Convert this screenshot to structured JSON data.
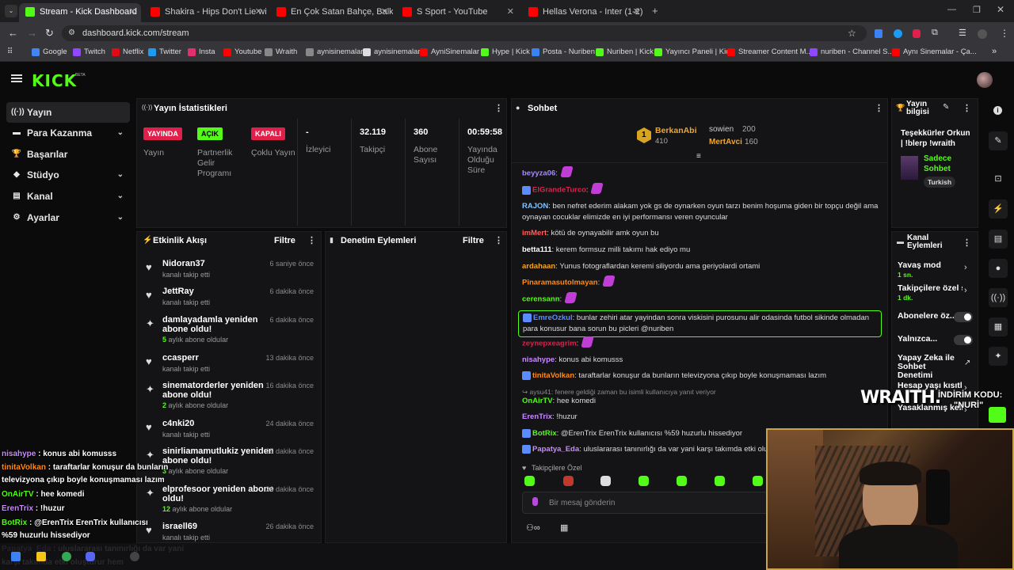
{
  "browser": {
    "tabs": [
      {
        "label": "Stream - Kick Dashboard",
        "active": true,
        "color": "#53fc18"
      },
      {
        "label": "Shakira - Hips Don't Lie with Ed",
        "active": false,
        "color": "#ff0000"
      },
      {
        "label": "En Çok Satan Bahçe, Balkon ve",
        "active": false,
        "color": "#ff0000"
      },
      {
        "label": "S Sport - YouTube",
        "active": false,
        "color": "#ff0000"
      },
      {
        "label": "Hellas Verona - Inter (1-2) - Ma",
        "active": false,
        "color": "#ff0000"
      }
    ],
    "url": "dashboard.kick.com/stream",
    "bookmarks": [
      {
        "label": "Google",
        "color": "#4285f4"
      },
      {
        "label": "Twitch",
        "color": "#9146ff"
      },
      {
        "label": "Netflix",
        "color": "#e50914"
      },
      {
        "label": "Twitter",
        "color": "#1d9bf0"
      },
      {
        "label": "Insta",
        "color": "#e1306c"
      },
      {
        "label": "Youtube",
        "color": "#ff0000"
      },
      {
        "label": "Wraith",
        "color": "#888888"
      },
      {
        "label": "aynisinemalar",
        "color": "#888888"
      },
      {
        "label": "aynisinemalar",
        "color": "#dddddd"
      },
      {
        "label": "AyniSinemalar",
        "color": "#ff0000"
      },
      {
        "label": "Hype | Kick",
        "color": "#53fc18"
      },
      {
        "label": "Posta - Nuriben",
        "color": "#3b82f6"
      },
      {
        "label": "Nuriben | Kick",
        "color": "#53fc18"
      },
      {
        "label": "Yayıncı Paneli | Kick",
        "color": "#53fc18"
      },
      {
        "label": "Streamer Content M...",
        "color": "#ff0000"
      },
      {
        "label": "nuriben - Channel S...",
        "color": "#9146ff"
      },
      {
        "label": "Aynı Sinemalar - Ça...",
        "color": "#ff0000"
      }
    ]
  },
  "sidebar": {
    "items": [
      {
        "label": "Yayın",
        "icon": "broadcast-icon",
        "glyph": "((·))",
        "chevron": false
      },
      {
        "label": "Para Kazanma",
        "icon": "money-icon",
        "glyph": "▬",
        "chevron": true
      },
      {
        "label": "Başarılar",
        "icon": "trophy-icon",
        "glyph": "🏆",
        "chevron": false
      },
      {
        "label": "Stüdyo",
        "icon": "studio-icon",
        "glyph": "◆",
        "chevron": true
      },
      {
        "label": "Kanal",
        "icon": "channel-icon",
        "glyph": "▤",
        "chevron": true
      },
      {
        "label": "Ayarlar",
        "icon": "gear-icon",
        "glyph": "⚙",
        "chevron": true
      }
    ]
  },
  "stats": {
    "title": "Yayın İstatistikleri",
    "badges": [
      {
        "badge": "YAYINDA",
        "label": "Yayın",
        "color": "#e0204a",
        "text": "#ffffff"
      },
      {
        "badge": "AÇIK",
        "label": "Partnerlik Gelir Programı",
        "color": "#53fc18",
        "text": "#000000"
      },
      {
        "badge": "KAPALI",
        "label": "Çoklu Yayın",
        "color": "#e0204a",
        "text": "#ffffff"
      }
    ],
    "values": [
      {
        "value": "-",
        "label": "İzleyici"
      },
      {
        "value": "32.119",
        "label": "Takipçi"
      },
      {
        "value": "360",
        "label": "Abone Sayısı"
      },
      {
        "value": "00:59:58",
        "label": "Yayında Olduğu Süre"
      }
    ]
  },
  "activity": {
    "title": "Etkinlik Akışı",
    "filter": "Filtre",
    "items": [
      {
        "name": "Nidoran37",
        "sub": "kanalı takip etti",
        "months": "",
        "time": "6 saniye önce",
        "icon": "heart"
      },
      {
        "name": "JettRay",
        "sub": "kanalı takip etti",
        "months": "",
        "time": "6 dakika önce",
        "icon": "heart"
      },
      {
        "name": "damlayadamla yeniden abone oldu!",
        "sub": " aylık abone oldular",
        "months": "5",
        "time": "6 dakika önce",
        "icon": "star"
      },
      {
        "name": "ccasperr",
        "sub": "kanalı takip etti",
        "months": "",
        "time": "13 dakika önce",
        "icon": "heart"
      },
      {
        "name": "sinematorderler yeniden abone oldu!",
        "sub": " aylık abone oldular",
        "months": "2",
        "time": "16 dakika önce",
        "icon": "star"
      },
      {
        "name": "c4nki20",
        "sub": "kanalı takip etti",
        "months": "",
        "time": "24 dakika önce",
        "icon": "heart"
      },
      {
        "name": "sinirliamamutlukiz yeniden abone oldu!",
        "sub": " aylık abone oldular",
        "months": "3",
        "time": "25 dakika önce",
        "icon": "star"
      },
      {
        "name": "elprofesoor yeniden abone oldu!",
        "sub": " aylık abone oldular",
        "months": "12",
        "time": "26 dakika önce",
        "icon": "star"
      },
      {
        "name": "israell69",
        "sub": "kanalı takip etti",
        "months": "",
        "time": "26 dakika önce",
        "icon": "heart"
      }
    ]
  },
  "moderation": {
    "title": "Denetim Eylemleri",
    "filter": "Filtre"
  },
  "chat": {
    "title": "Sohbet",
    "leaders": [
      {
        "rank": "1",
        "name": "BerkanAbi",
        "count": "410"
      },
      {
        "rank": "",
        "name": "sowien",
        "count": "200"
      },
      {
        "rank": "",
        "name": "MertAvci",
        "count": "160"
      }
    ],
    "messages": [
      {
        "user": "beyyza06",
        "color": "#a58bff",
        "text": "",
        "emote": true
      },
      {
        "user": "ElGrandeTurco",
        "color": "#e0204a",
        "text": "",
        "emote": true
      },
      {
        "user": "RAJON",
        "color": "#7fc4ff",
        "text": "ben nefret ederim alakam yok gs de oynarken oyun tarzı benim hoşuma giden bir topçu değil ama oynayan cocuklar elimizde en iyi performansı veren oyuncular"
      },
      {
        "user": "imMert",
        "color": "#ff5f5f",
        "text": "kötü de oynayabilir amk oyun bu"
      },
      {
        "user": "betta111",
        "color": "#ffffff",
        "text": "kerem formsuz milli takımı hak ediyo mu"
      },
      {
        "user": "ardahaan",
        "color": "#f5a623",
        "text": "Yunus fotograflardan keremi siliyordu ama geriyolardi ortami"
      },
      {
        "user": "Pinaramasutolmayan",
        "color": "#ff8c1a",
        "text": "",
        "emote": true
      },
      {
        "user": "cerensann",
        "color": "#53fc18",
        "text": "",
        "emote": true
      },
      {
        "user": "EmreOzkul",
        "color": "#5a8cff",
        "text": "bunlar zehiri atar yayindan sonra viskisini purosunu alir odasinda futbol sikinde olmadan para konusur bana sorun bu picleri @nuriben"
      },
      {
        "user": "zeynepxeagrim",
        "color": "#e0204a",
        "text": "",
        "emote": true
      },
      {
        "user": "nisahype",
        "color": "#c98bff",
        "text": "konus abi komusss"
      },
      {
        "user": "tinitaVolkan",
        "color": "#ff8c1a",
        "text": "taraftarlar konuşur da bunların televizyona çıkıp boyle konuşmaması lazım"
      },
      {
        "user": "",
        "color": "#8a8a8a",
        "text": "↪ aysu41: fenere geldiği zaman bu isimli kullanıcıya yanıt veriyor"
      },
      {
        "user": "OnAirTV",
        "color": "#53fc18",
        "text": "hee komedi"
      },
      {
        "user": "ErenTrix",
        "color": "#c98bff",
        "text": "!huzur"
      },
      {
        "user": "BotRix",
        "color": "#53fc18",
        "text": "@ErenTrix ErenTrix kullanıcısı %59 huzurlu hissediyor"
      },
      {
        "user": "Papatya_Eda",
        "color": "#c98bff",
        "text": "uluslararası tanınırlığı da var yani karşı takımda etki oluştu"
      }
    ],
    "followers_only": "Takipçilere Özel",
    "input_placeholder": "Bir mesaj gönderin"
  },
  "right": {
    "info_title": "Yayın bilgisi",
    "info_text": "Teşekkürler Orkun | !blerp !wraith",
    "info_category": "Sadece Sohbet",
    "info_tag": "Turkish",
    "actions_title": "Kanal Eylemleri",
    "actions": [
      {
        "label": "Yavaş mod",
        "sub": "1 sn.",
        "type": "chevron"
      },
      {
        "label": "Takipçilere özel s",
        "sub": "1 dk.",
        "type": "chevron"
      },
      {
        "label": "Abonelere öz...",
        "sub": "",
        "type": "toggle"
      },
      {
        "label": "Yalnızca...",
        "sub": "",
        "type": "toggle"
      },
      {
        "label": "Yapay Zeka ile Sohbet Denetimi",
        "sub": "",
        "type": "link"
      },
      {
        "label": "Hesap yaşı kısıtla",
        "sub": "",
        "type": "chevron"
      },
      {
        "label": "Yasaklanmış kelim",
        "sub": "",
        "type": "chevron"
      }
    ]
  },
  "overlay": {
    "sponsor": "WRAITH.",
    "promo_label": "İNDİRİM KODU:",
    "promo_code": "\"NURİ\"",
    "lines": [
      {
        "user": "nisahype",
        "color": "#c98bff",
        "text": " : konus abi komusss"
      },
      {
        "user": "tinitaVolkan",
        "color": "#ff8c1a",
        "text": " : taraftarlar konuşur da bunların"
      },
      {
        "user": "",
        "color": "#ffffff",
        "text": "televizyona çıkıp boyle konuşmaması lazım"
      },
      {
        "user": "OnAirTV",
        "color": "#53fc18",
        "text": " : hee komedi"
      },
      {
        "user": "ErenTrix",
        "color": "#c98bff",
        "text": " : !huzur"
      },
      {
        "user": "BotRix",
        "color": "#53fc18",
        "text": " : @ErenTrix ErenTrix kullanıcısı"
      },
      {
        "user": "",
        "color": "#ffffff",
        "text": "%59 huzurlu hissediyor"
      },
      {
        "user": "Papatya_Eda",
        "color": "#c98bff",
        "text": " : uluslararası tanınırlığı da var yani"
      },
      {
        "user": "",
        "color": "#ffffff",
        "text": "karşı takımda etki oluşturur hem"
      }
    ]
  }
}
